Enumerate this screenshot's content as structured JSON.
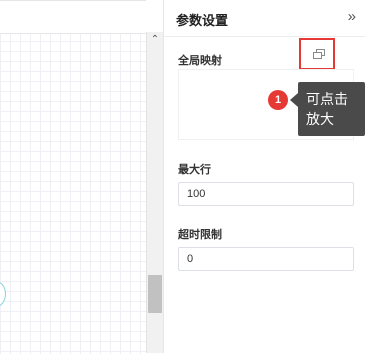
{
  "panel": {
    "title": "参数设置",
    "collapse_icon": "»",
    "fields": {
      "global_mapping": {
        "label": "全局映射"
      },
      "max_rows": {
        "label": "最大行",
        "value": "100"
      },
      "timeout_limit": {
        "label": "超时限制",
        "value": "0"
      }
    }
  },
  "scrollbar": {
    "up_arrow": "⌃"
  },
  "annotation": {
    "badge": "1",
    "tooltip_line1": "可点击",
    "tooltip_line2": "放大"
  },
  "colors": {
    "highlight": "#e53935",
    "tooltip_bg": "#4a4a4a",
    "node_stroke": "#86d3de"
  }
}
